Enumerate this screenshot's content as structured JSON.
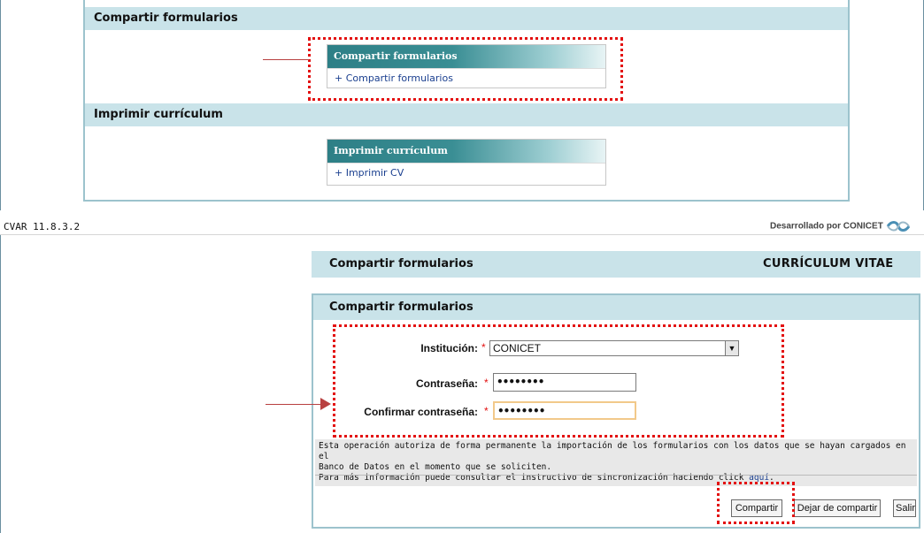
{
  "top": {
    "sections": [
      {
        "header": "Compartir formularios",
        "box_title": "Compartir formularios",
        "box_link": "+ Compartir formularios"
      },
      {
        "header": "Imprimir currículum",
        "box_title": "Imprimir currículum",
        "box_link": "+ Imprimir CV"
      }
    ]
  },
  "status": {
    "version": "CVAR  11.8.3.2",
    "developer": "Desarrollado por CONICET"
  },
  "page": {
    "title": "Compartir formularios",
    "subtitle": "CURRÍCULUM VITAE"
  },
  "form": {
    "header": "Compartir formularios",
    "institution_label": "Institución:",
    "institution_value": "CONICET",
    "password_label": "Contraseña:",
    "password_value": "••••••••",
    "confirm_label": "Confirmar contraseña:",
    "confirm_value": "••••••••",
    "required_mark": "*",
    "note_line1": "Esta operación autoriza de forma permanente la importación de los formularios con los datos que se hayan cargados en el",
    "note_line2": "Banco de Datos en el momento que se soliciten.",
    "note_line3": "Para más información puede consultar el instructivo de sincronización haciendo click ",
    "note_link": "aquí",
    "note_end": "."
  },
  "buttons": {
    "share": "Compartir",
    "unshare": "Dejar de compartir",
    "exit": "Salir"
  },
  "icons": {
    "select_arrow": "chevron-down-icon",
    "logo": "conicet-logo-icon"
  },
  "colors": {
    "header_bg": "#c9e3e9",
    "annotation": "#e31010",
    "box_head": "#2d7f86"
  }
}
